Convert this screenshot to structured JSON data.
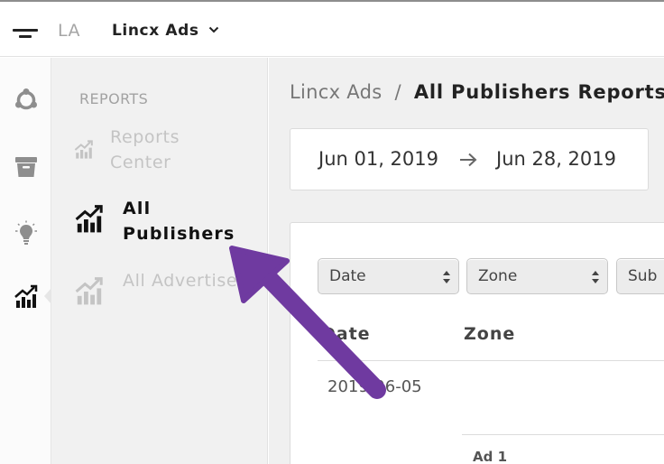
{
  "topbar": {
    "org_initials": "LA",
    "org_name": "Lincx Ads"
  },
  "rail": {
    "items": [
      {
        "icon": "network-icon"
      },
      {
        "icon": "archive-icon"
      },
      {
        "icon": "lightbulb-icon"
      },
      {
        "icon": "reports-chart-icon",
        "active": true
      }
    ]
  },
  "subnav": {
    "heading": "REPORTS",
    "items": [
      {
        "label": "Reports Center",
        "icon": "chart-icon",
        "active": false
      },
      {
        "label": "All Publishers",
        "icon": "chart-icon",
        "active": true
      },
      {
        "label": "All Advertisers",
        "icon": "chart-icon",
        "active": false
      }
    ]
  },
  "breadcrumb": {
    "parent": "Lincx Ads",
    "separator": "/",
    "current": "All Publishers Reports"
  },
  "date_range": {
    "start": "Jun 01, 2019",
    "end": "Jun 28, 2019"
  },
  "report": {
    "selects": [
      {
        "value": "Date"
      },
      {
        "value": "Zone"
      },
      {
        "value": "Sub"
      }
    ],
    "columns": [
      "Date",
      "Zone"
    ],
    "rows": [
      {
        "date": "2019-06-05"
      }
    ],
    "sub_rows": [
      {
        "label": "Ad 1"
      }
    ]
  },
  "colors": {
    "annotation_arrow": "#6f3aa0",
    "active_text": "#111111",
    "inactive_text": "#c4c4c4"
  }
}
